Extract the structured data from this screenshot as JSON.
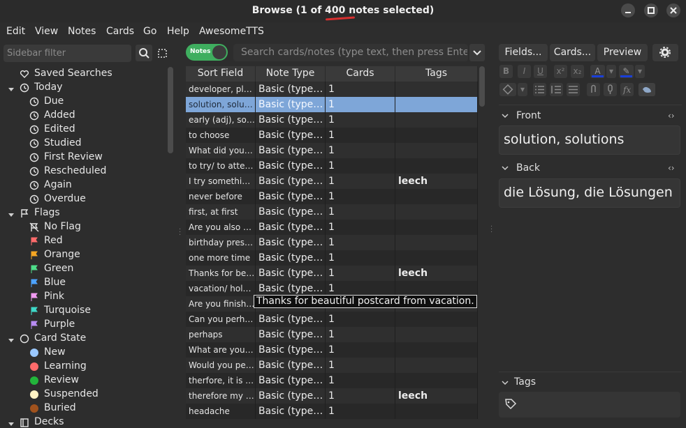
{
  "window": {
    "title": "Browse (1 of 400 notes selected)",
    "controls": [
      "minimize-icon",
      "maximize-icon",
      "close-icon"
    ]
  },
  "menubar": [
    "Edit",
    "View",
    "Notes",
    "Cards",
    "Go",
    "Help",
    "AwesomeTTS"
  ],
  "sidebar": {
    "filter_placeholder": "Sidebar filter",
    "items": [
      {
        "label": "Saved Searches",
        "icon": "heart-icon",
        "level": 0,
        "expandable": false
      },
      {
        "label": "Today",
        "icon": "clock-icon",
        "level": 0,
        "expandable": true
      },
      {
        "label": "Due",
        "icon": "clock-icon",
        "level": 1
      },
      {
        "label": "Added",
        "icon": "clock-icon",
        "level": 1
      },
      {
        "label": "Edited",
        "icon": "clock-icon",
        "level": 1
      },
      {
        "label": "Studied",
        "icon": "clock-icon",
        "level": 1
      },
      {
        "label": "First Review",
        "icon": "clock-icon",
        "level": 1
      },
      {
        "label": "Rescheduled",
        "icon": "clock-icon",
        "level": 1
      },
      {
        "label": "Again",
        "icon": "clock-icon",
        "level": 1
      },
      {
        "label": "Overdue",
        "icon": "clock-icon",
        "level": 1
      },
      {
        "label": "Flags",
        "icon": "flag-outline-icon",
        "level": 0,
        "expandable": true
      },
      {
        "label": "No Flag",
        "icon": "no-flag-icon",
        "level": 1
      },
      {
        "label": "Red",
        "icon": "flag-icon",
        "level": 1,
        "color": "#ff6b6b"
      },
      {
        "label": "Orange",
        "icon": "flag-icon",
        "level": 1,
        "color": "#f5a623"
      },
      {
        "label": "Green",
        "icon": "flag-icon",
        "level": 1,
        "color": "#4ede8a"
      },
      {
        "label": "Blue",
        "icon": "flag-icon",
        "level": 1,
        "color": "#4da3ff"
      },
      {
        "label": "Pink",
        "icon": "flag-icon",
        "level": 1,
        "color": "#f29bf2"
      },
      {
        "label": "Turquoise",
        "icon": "flag-icon",
        "level": 1,
        "color": "#3fd8c8"
      },
      {
        "label": "Purple",
        "icon": "flag-icon",
        "level": 1,
        "color": "#b88cf2"
      },
      {
        "label": "Card State",
        "icon": "circle-outline-icon",
        "level": 0,
        "expandable": true
      },
      {
        "label": "New",
        "icon": "dot-icon",
        "level": 1,
        "color": "#9ac8ff"
      },
      {
        "label": "Learning",
        "icon": "dot-icon",
        "level": 1,
        "color": "#ff6b6b"
      },
      {
        "label": "Review",
        "icon": "dot-icon",
        "level": 1,
        "color": "#22b53b"
      },
      {
        "label": "Suspended",
        "icon": "dot-icon",
        "level": 1,
        "color": "#fff3c4"
      },
      {
        "label": "Buried",
        "icon": "dot-icon",
        "level": 1,
        "color": "#a0521d"
      },
      {
        "label": "Decks",
        "icon": "deck-icon",
        "level": 0,
        "expandable": true
      }
    ]
  },
  "toolbar": {
    "toggle_label": "Notes",
    "search_placeholder": "Search cards/notes (type text, then press Enter)"
  },
  "table": {
    "columns": [
      "Sort Field",
      "Note Type",
      "Cards",
      "Tags"
    ],
    "rows": [
      {
        "sort": "developer, plur...",
        "type": "Basic (type ...",
        "cards": "1",
        "tags": ""
      },
      {
        "sort": "solution, soluti...",
        "type": "Basic (type ...",
        "cards": "1",
        "tags": "",
        "selected": true
      },
      {
        "sort": "early (adj), soo...",
        "type": "Basic (type ...",
        "cards": "1",
        "tags": ""
      },
      {
        "sort": "to choose",
        "type": "Basic (type ...",
        "cards": "1",
        "tags": ""
      },
      {
        "sort": "What did you c...",
        "type": "Basic (type ...",
        "cards": "1",
        "tags": ""
      },
      {
        "sort": "to try/ to attem...",
        "type": "Basic (type ...",
        "cards": "1",
        "tags": ""
      },
      {
        "sort": "I try something...",
        "type": "Basic (type ...",
        "cards": "1",
        "tags": "leech"
      },
      {
        "sort": "never before",
        "type": "Basic (type ...",
        "cards": "1",
        "tags": ""
      },
      {
        "sort": "first, at first",
        "type": "Basic (type ...",
        "cards": "1",
        "tags": ""
      },
      {
        "sort": "Are you also g...",
        "type": "Basic (type ...",
        "cards": "1",
        "tags": ""
      },
      {
        "sort": "birthday present",
        "type": "Basic (type ...",
        "cards": "1",
        "tags": ""
      },
      {
        "sort": "one more time",
        "type": "Basic (type ...",
        "cards": "1",
        "tags": ""
      },
      {
        "sort": "Thanks for bea...",
        "type": "Basic (type ...",
        "cards": "1",
        "tags": "leech"
      },
      {
        "sort": "vacation/ holday",
        "type": "Basic (type ...",
        "cards": "1",
        "tags": ""
      },
      {
        "sort": "Are you finishe...",
        "type": "",
        "cards": "",
        "tags": ""
      },
      {
        "sort": "Can you perha...",
        "type": "Basic (type ...",
        "cards": "1",
        "tags": ""
      },
      {
        "sort": "perhaps",
        "type": "Basic (type ...",
        "cards": "1",
        "tags": ""
      },
      {
        "sort": "What are you ...",
        "type": "Basic (type ...",
        "cards": "1",
        "tags": ""
      },
      {
        "sort": "Would you per...",
        "type": "Basic (type ...",
        "cards": "1",
        "tags": ""
      },
      {
        "sort": "therfore, it is pr...",
        "type": "Basic (type ...",
        "cards": "1",
        "tags": ""
      },
      {
        "sort": "therefore my m...",
        "type": "Basic (type ...",
        "cards": "1",
        "tags": "leech"
      },
      {
        "sort": "headache",
        "type": "Basic (type ...",
        "cards": "1",
        "tags": ""
      }
    ],
    "tooltip": "Thanks for beautiful postcard from vacation."
  },
  "editor": {
    "buttons": {
      "fields": "Fields...",
      "cards": "Cards...",
      "preview": "Preview"
    },
    "format_row1": [
      "B",
      "I",
      "U",
      "x²",
      "x₂",
      "A",
      "▾",
      "✎",
      "▾"
    ],
    "fields": [
      {
        "label": "Front",
        "value": "solution, solutions"
      },
      {
        "label": "Back",
        "value": "die Lösung, die Lösungen"
      }
    ],
    "tags_label": "Tags"
  },
  "colors": {
    "accent_green": "#3fae5f",
    "selection": "#7ea6d8",
    "text_color_bar": "#1a3fd8"
  }
}
